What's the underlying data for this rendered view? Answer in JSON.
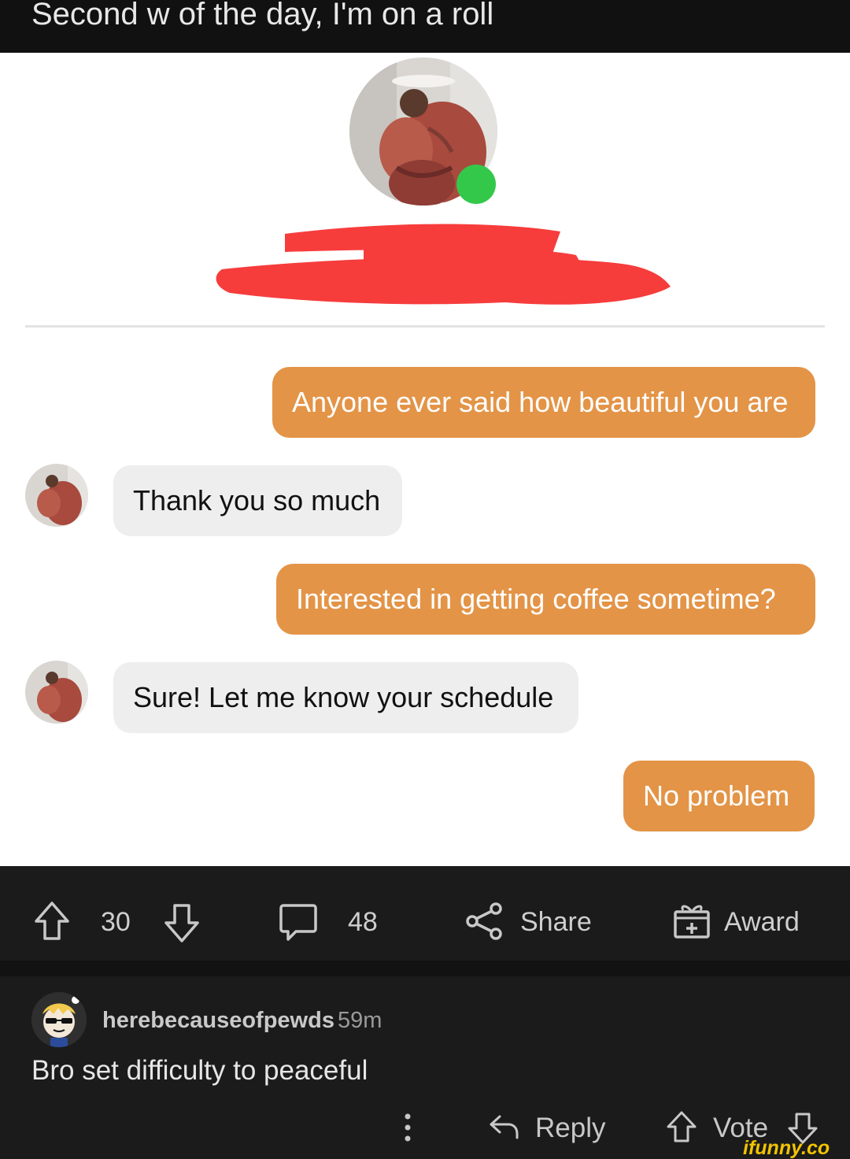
{
  "post": {
    "title": "Second w of the day, I'm on a roll"
  },
  "chat": {
    "messages": [
      {
        "from": "sent",
        "text": "Anyone ever said how beautiful you are"
      },
      {
        "from": "received",
        "text": "Thank you so much"
      },
      {
        "from": "sent",
        "text": "Interested in getting coffee sometime?"
      },
      {
        "from": "received",
        "text": "Sure! Let me know your schedule"
      },
      {
        "from": "sent",
        "text": "No problem"
      }
    ],
    "colors": {
      "sent_bubble": "#e39447",
      "received_bubble": "#eeeeee",
      "online_dot": "#33c84a",
      "redaction": "#f73c3c"
    },
    "icons": {
      "profile_avatar": "profile-photo",
      "online_status": "online-dot",
      "redaction": "red-scribble"
    }
  },
  "actions": {
    "upvote_count": "30",
    "comment_count": "48",
    "share_label": "Share",
    "award_label": "Award",
    "icons": [
      "upvote-arrow-icon",
      "downvote-arrow-icon",
      "comment-bubble-icon",
      "share-icon",
      "award-gift-icon"
    ]
  },
  "comment": {
    "username": "herebecauseofpewds",
    "time": "59m",
    "body": "Bro set difficulty to peaceful",
    "reply_label": "Reply",
    "vote_label": "Vote",
    "icons": [
      "more-options-icon",
      "reply-arrow-icon",
      "upvote-arrow-icon",
      "downvote-arrow-icon"
    ]
  },
  "watermark": "ifunny.co"
}
